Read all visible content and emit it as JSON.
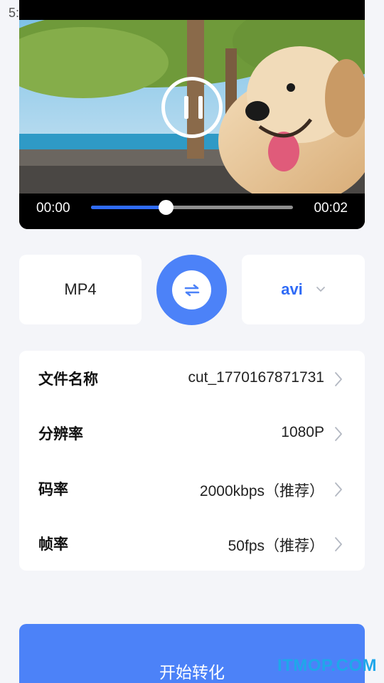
{
  "status_bar": {
    "time": "5:"
  },
  "player": {
    "current_time": "00:00",
    "total_time": "00:02",
    "progress_fraction": 0.37,
    "state_icon": "pause-icon"
  },
  "format": {
    "source": "MP4",
    "target": "avi",
    "swap_icon": "swap-arrows-icon",
    "dropdown_icon": "chevron-down-icon"
  },
  "settings": [
    {
      "label": "文件名称",
      "value": "cut_1770167871731"
    },
    {
      "label": "分辨率",
      "value": "1080P"
    },
    {
      "label": "码率",
      "value": "2000kbps（推荐）"
    },
    {
      "label": "帧率",
      "value": "50fps（推荐）"
    }
  ],
  "start_button": {
    "label": "开始转化"
  },
  "watermark": "ITMOP.COM",
  "colors": {
    "accent": "#4c82f8",
    "progress": "#2f6bf6",
    "background": "#f4f5f9"
  }
}
